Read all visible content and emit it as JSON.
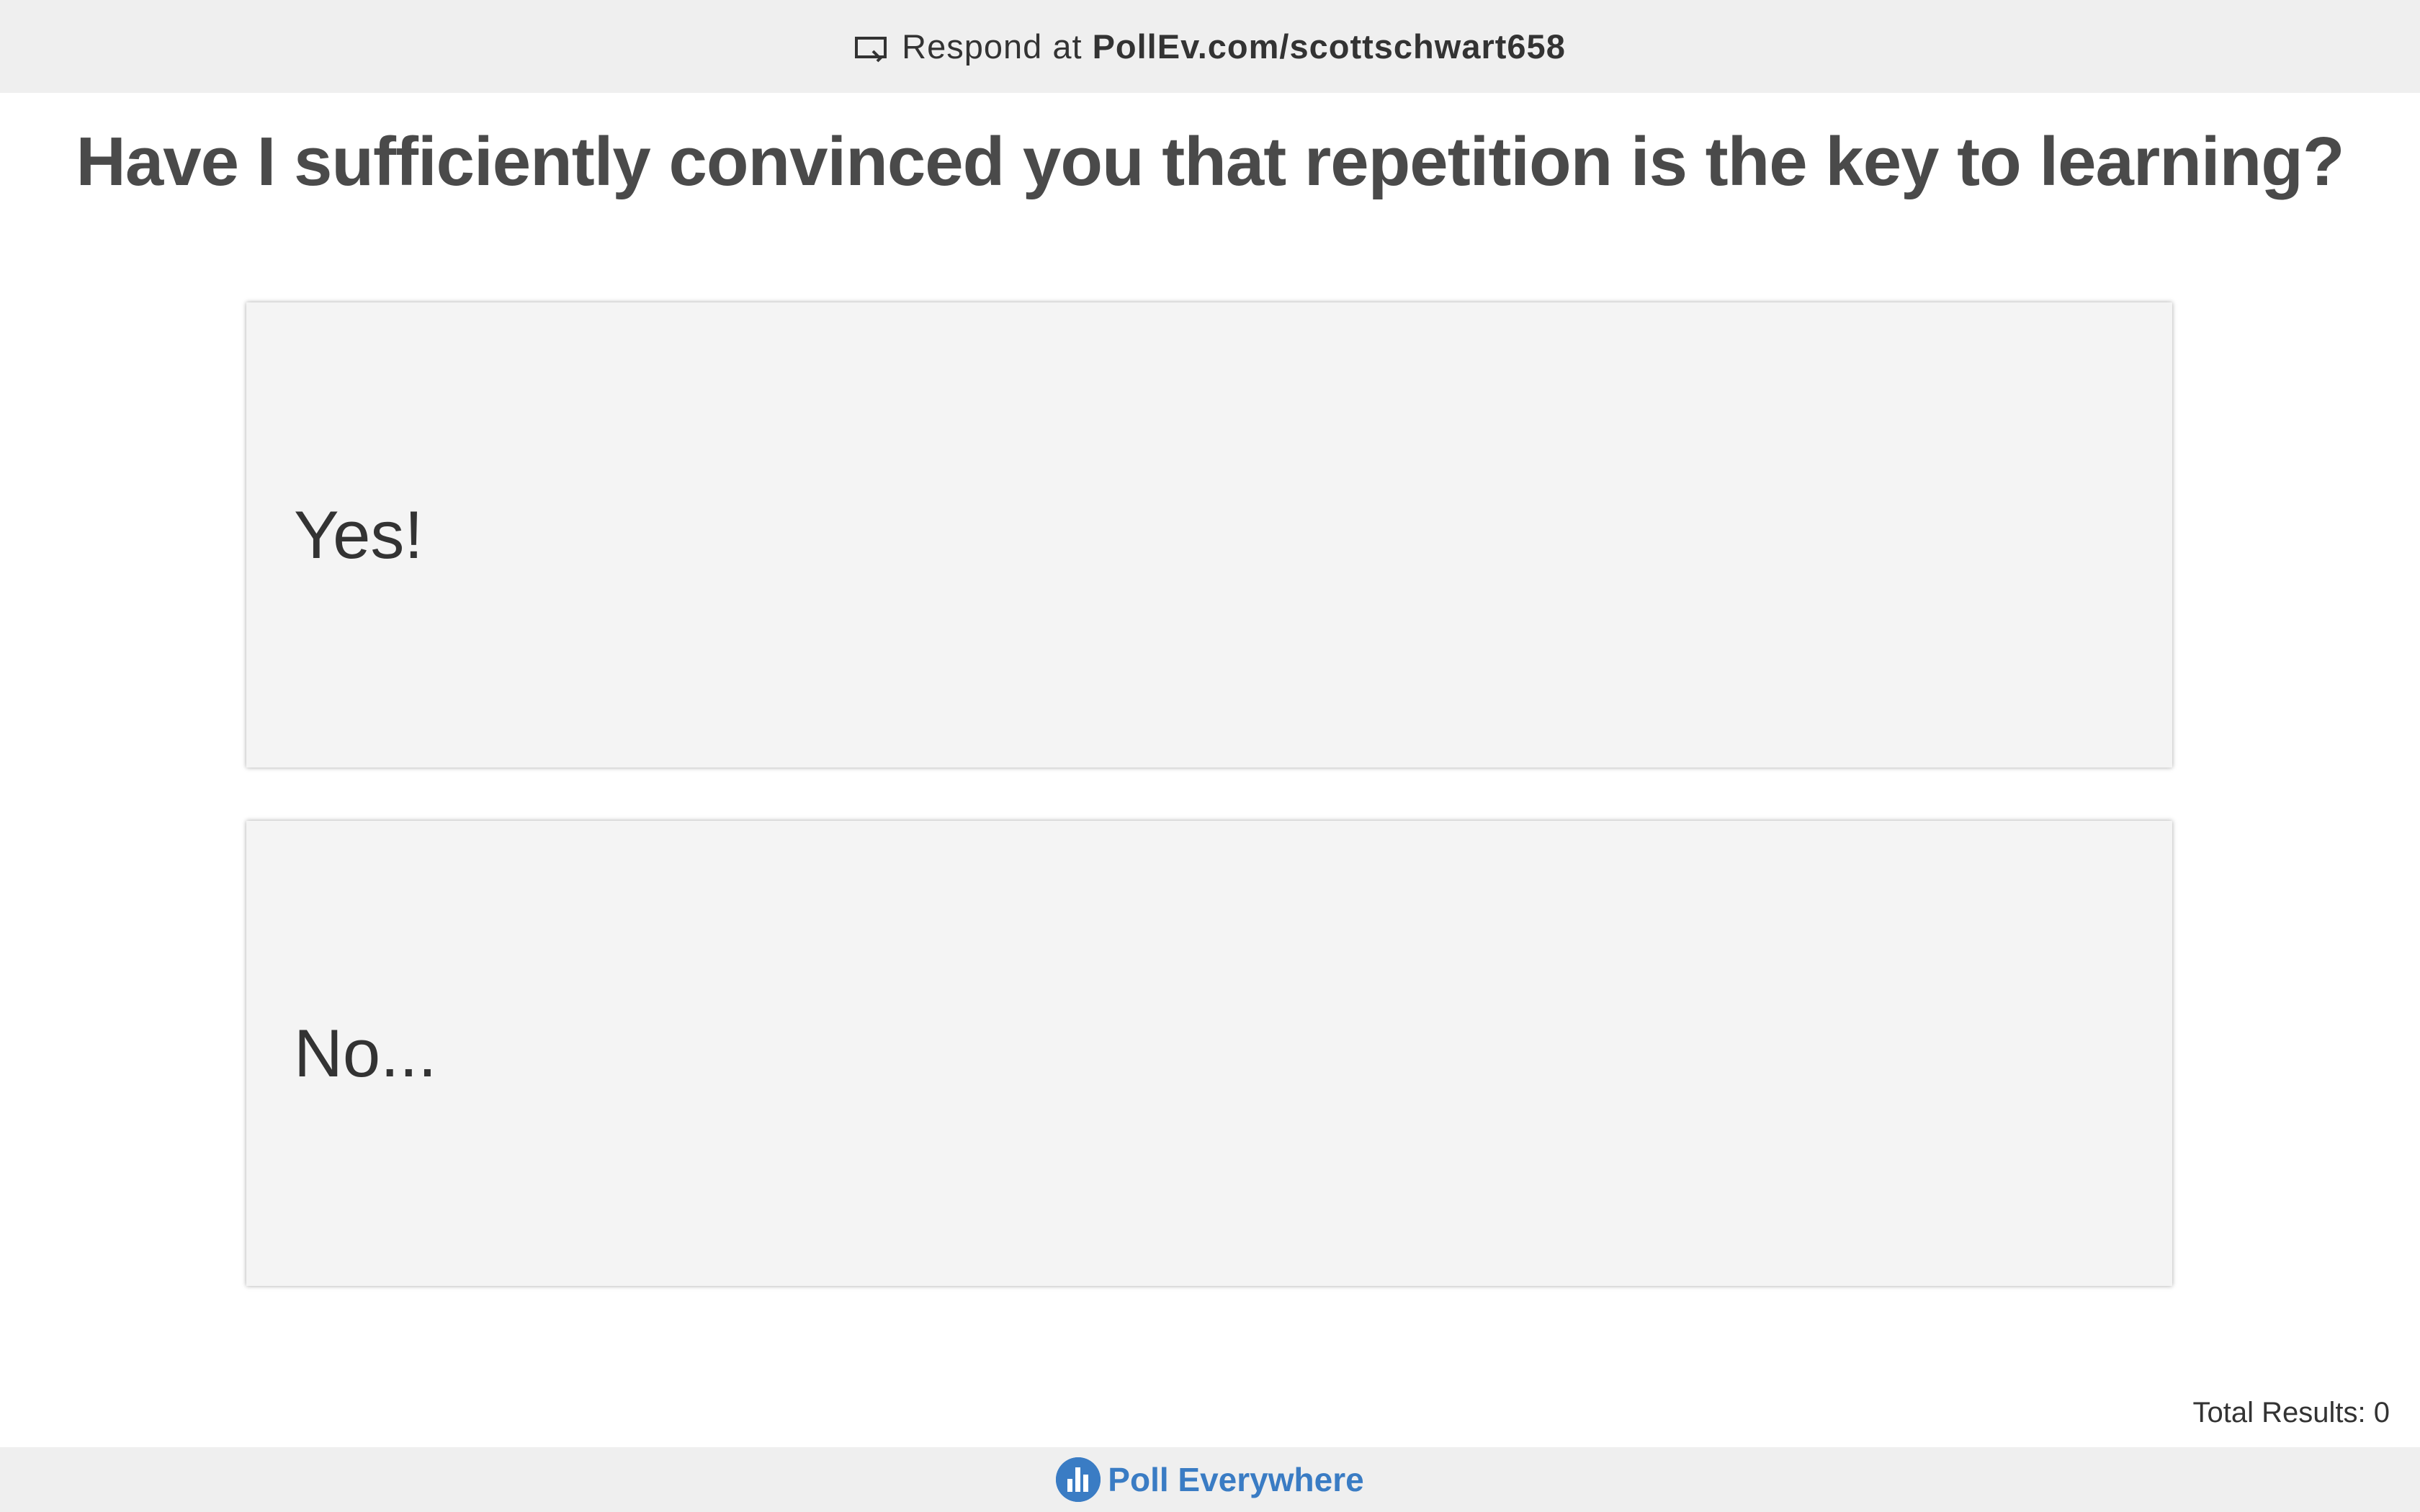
{
  "header": {
    "respond_prefix": "Respond at",
    "respond_url": "PollEv.com/scottschwart658",
    "icon": "presenter-screen-icon"
  },
  "question": {
    "title": "Have I sufficiently convinced you that repetition is the key to learning?"
  },
  "options": [
    {
      "label": "Yes!"
    },
    {
      "label": "No..."
    }
  ],
  "results": {
    "total_label": "Total Results: 0"
  },
  "footer": {
    "brand_name": "Poll Everywhere",
    "brand_icon": "poll-everywhere-logo-icon",
    "brand_color": "#3a7cc4"
  },
  "colors": {
    "bar_background": "#efefef",
    "card_background": "#f4f4f4",
    "title_text": "#4a4a4a"
  }
}
